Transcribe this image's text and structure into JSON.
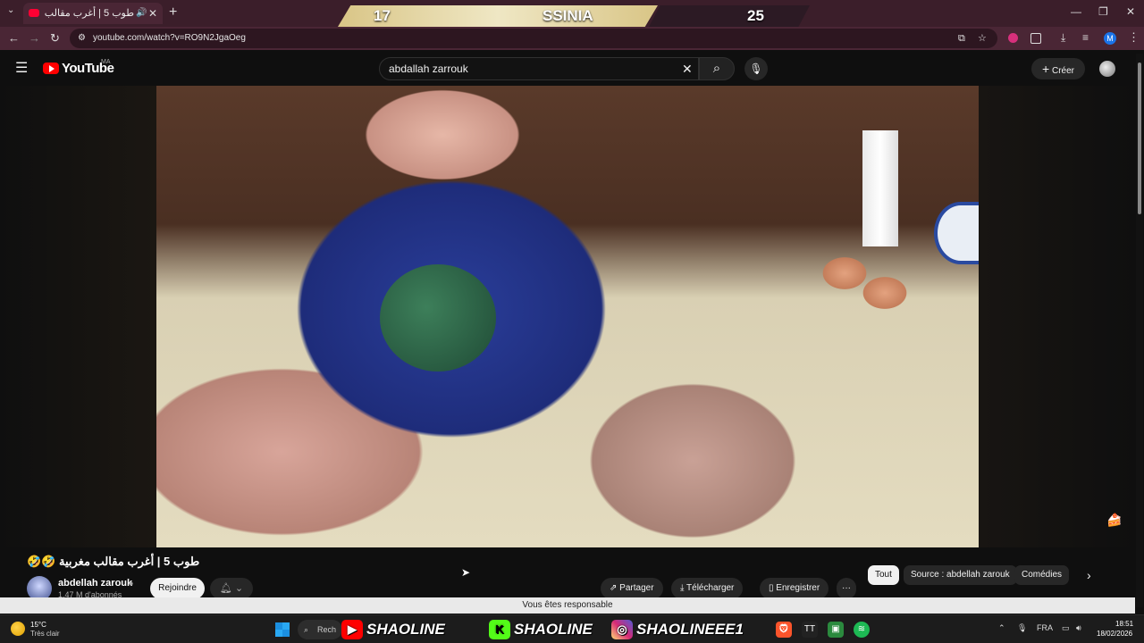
{
  "browser": {
    "tab_title": "طوب 5 | أغرب مقالب مغربية",
    "tab_close": "✕",
    "new_tab": "+",
    "url": "youtube.com/watch?v=RO9N2JgaOeg",
    "profile_initial": "M"
  },
  "score_overlay": {
    "left_score": "17",
    "name": "SSINIA",
    "right_score": "25"
  },
  "youtube": {
    "logo_text": "YouTube",
    "country_code": "MA",
    "search_value": "abdallah zarrouk",
    "create_label": "Créer"
  },
  "video": {
    "title": "طوب 5 | أغرب مقالب مغربية 🤣🤣",
    "channel_name": "abdellah zarouk",
    "subscribers": "1,47 M d'abonnés",
    "join_label": "Rejoindre",
    "actions": {
      "share": "Partager",
      "download": "Télécharger",
      "save": "Enregistrer",
      "more": "···"
    },
    "chips": {
      "all": "Tout",
      "source": "Source : abdellah zarouk",
      "comedies": "Comédies"
    }
  },
  "toast": "Vous êtes responsable",
  "taskbar": {
    "weather_temp": "15°C",
    "weather_desc": "Très clair",
    "search_label": "Rech",
    "social": {
      "youtube": "SHAOLINE",
      "kick": "SHAOLINE",
      "instagram": "SHAOLINEEE1"
    },
    "lang": "FRA",
    "time": "18:51",
    "date": "18/02/2026"
  },
  "colors": {
    "yt_red": "#ff0000",
    "kick_green": "#53fc18",
    "instagram_pink": "#d62976",
    "browser_frame": "#3b1e2a"
  }
}
